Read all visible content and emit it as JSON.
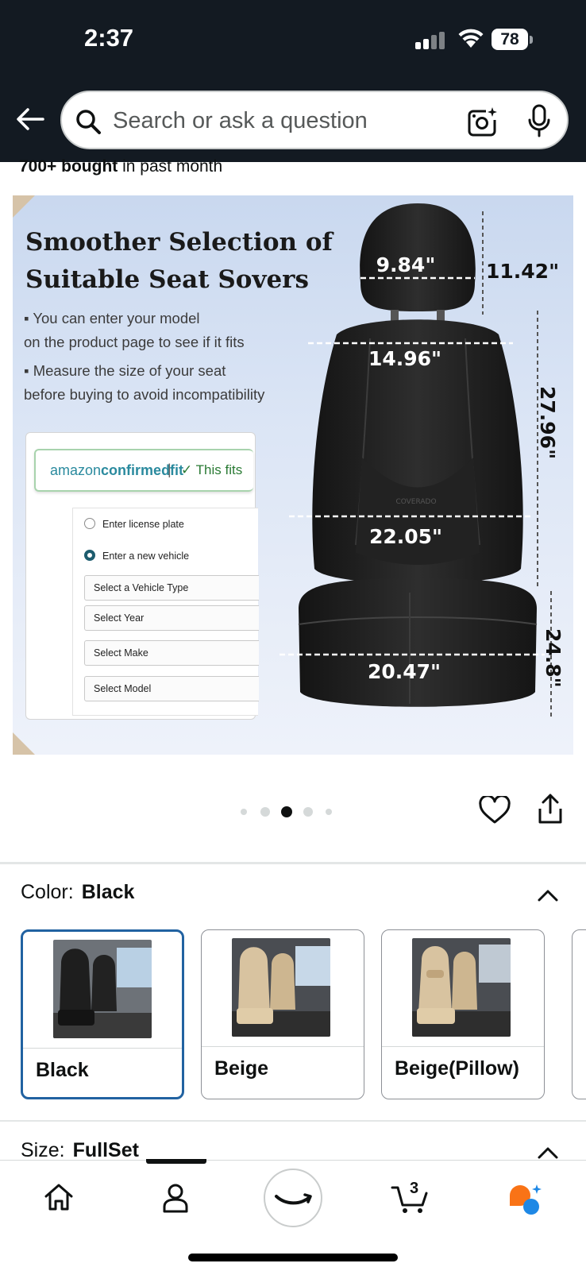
{
  "status_bar": {
    "time": "2:37",
    "battery": "78"
  },
  "search": {
    "placeholder": "Search or ask a question"
  },
  "social_proof": {
    "bold": "700+ bought",
    "rest": " in past month"
  },
  "product_image": {
    "title_line1": "Smoother Selection of",
    "title_line2": "Suitable Seat Sovers",
    "bullet1_line1": "▪ You can enter your model",
    "bullet1_line2": "on the product page to see if it fits",
    "bullet2_line1": "▪ Measure the size of your seat",
    "bullet2_line2": "before buying to avoid incompatibility",
    "fit_brand_a": "amazon",
    "fit_brand_b": "confirmedfit",
    "fit_sep": "|",
    "fit_check": "✓ This fits",
    "radio_license": "Enter license plate",
    "radio_new_vehicle": "Enter a new vehicle",
    "select_vehicle_type": "Select a Vehicle Type",
    "select_year": "Select Year",
    "select_make": "Select Make",
    "select_model": "Select Model",
    "seat_brand": "COVERADO",
    "dimensions": {
      "headrest_width": "9.84\"",
      "headrest_height": "11.42\"",
      "shoulder_width": "14.96\"",
      "backrest_height": "27.96\"",
      "lumbar_width": "22.05\"",
      "cushion_width": "20.47\"",
      "cushion_height": "24.8\""
    }
  },
  "carousel": {
    "total": 5,
    "active_index": 2
  },
  "color": {
    "label": "Color:",
    "value": "Black",
    "options": [
      {
        "name": "Black",
        "selected": true,
        "seat_color": "#2b2b2b"
      },
      {
        "name": "Beige",
        "selected": false,
        "seat_color": "#d8c3a0"
      },
      {
        "name": "Beige(Pillow)",
        "selected": false,
        "seat_color": "#d8c3a0"
      }
    ]
  },
  "size": {
    "label": "Size:",
    "value": "FullSet"
  },
  "bottom_nav": {
    "cart_count": "3"
  },
  "colors": {
    "header_bg": "#131a22",
    "selected_border": "#2162a1",
    "fit_teal": "#2a8a9e",
    "fit_green": "#2a7a34",
    "assistant_orange": "#f97316",
    "assistant_blue": "#1e88e5"
  }
}
